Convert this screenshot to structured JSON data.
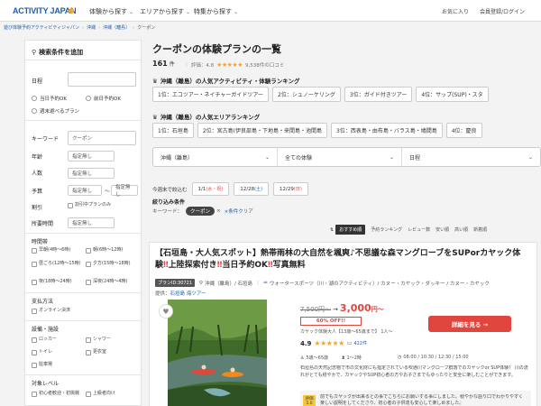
{
  "header": {
    "logo": "ACTIVITY JAPAN",
    "nav": [
      "体験から探す",
      "エリアから探す",
      "特集から探す"
    ],
    "favorites": "お気に入り",
    "member": "会員登録/ログイン"
  },
  "breadcrumb": {
    "items": [
      "遊び体験予約アクティビティジャパン",
      "沖縄",
      "沖縄（離島）"
    ],
    "current": "クーポン"
  },
  "sidebar": {
    "title": "検索条件を追加",
    "date_label": "日程",
    "date_options": [
      "当日予約OK",
      "前日予約OK",
      "週末遊べるプラン"
    ],
    "keyword_label": "キーワード",
    "keyword_value": "クーポン",
    "age_label": "年齢",
    "age_placeholder": "指定無し",
    "people_label": "人数",
    "people_placeholder": "指定無し",
    "budget_label": "予算",
    "budget_min": "指定無し",
    "budget_sep": "〜",
    "budget_max": "指定無し",
    "discount_label": "割引",
    "discount_option": "割引中プランのみ",
    "duration_label": "所要時間",
    "duration_placeholder": "指定無し",
    "time_label": "時間帯",
    "time_options": [
      "早朝(4時〜6時)",
      "朝(6時〜12時)",
      "昼ごろ(12時〜15時)",
      "夕方(15時〜18時)",
      "夜(18時〜24時)",
      "深夜(24時〜4時)"
    ],
    "payment_label": "支払方法",
    "payment_option": "オンライン決済",
    "facility_label": "設備・施設",
    "facility_options": [
      "ロッカー",
      "シャワー",
      "トイレ",
      "更衣室",
      "駐車場"
    ],
    "target_label": "対象レベル",
    "target_options": [
      "初心者歓迎・初挑戦",
      "上級者向け"
    ]
  },
  "main": {
    "title": "クーポンの体験プランの一覧",
    "count": "161",
    "count_unit": "件",
    "rating_label": "評価：4.8",
    "rating_reviews": "9,538件の口コミ",
    "activity_ranking_title": "沖縄（離島）の人気アクティビティ・体験ランキング",
    "activity_ranking": [
      "1位：エコツアー・ネイチャーガイドツアー",
      "2位：シュノーケリング",
      "3位：ガイド付きツアー",
      "4位：サップ(SUP)・スタ"
    ],
    "area_ranking_title": "沖縄（離島）の人気エリアランキング",
    "area_ranking": [
      "1位：石垣島",
      "2位：宮古島(伊良部島・下地島・来間島・池間島",
      "3位：西表島・由布島・バラス島・鳩間島",
      "4位：慶良"
    ],
    "search": {
      "area": "沖縄（離島）",
      "category": "全ての体験",
      "date": "日程"
    },
    "quick_label": "今週末で絞込む",
    "quick_dates": [
      {
        "d": "1/1",
        "w": "(水・祝)"
      },
      {
        "d": "12/28",
        "w": "(土)"
      },
      {
        "d": "12/29",
        "w": "(日)"
      }
    ],
    "filter_title": "絞り込み条件",
    "filter_keyword_label": "キーワード：",
    "filter_keyword_chip": "クーポン",
    "filter_clear": "条件クリア",
    "sort": [
      "おすすめ順",
      "予約ランキング",
      "レビュー数",
      "安い順",
      "高い順",
      "新着順"
    ]
  },
  "card": {
    "title_a": "【石垣島・大人気スポット】熱帯雨林の大自然を颯爽♪不思議な森マングローブをSUPorカヤック体験",
    "title_b": "上陸探索付き",
    "title_c": "当日予約OK",
    "title_d": "写真無料",
    "bang": "‼",
    "plan_id": "プランID:30721",
    "location": "沖縄（離島）/ 石垣島",
    "category": "ウォータースポーツ（川・湖のアクティビティ）/ カヌー・カヤック・ダッキー / カヌー・カヤック",
    "provider_label": "提供：",
    "provider": "石垣島 海ツアー",
    "old_price": "7,500円〜",
    "new_price": "3,000",
    "new_price_unit": "円〜",
    "off": "60% OFF!!",
    "price_note": "カヤック体験大人【13歳〜65歳まで】 1人〜",
    "detail_btn": "詳細を見る →",
    "score": "4.9",
    "review_count": "422件",
    "age": "5歳〜65歳",
    "duration": "1〜2時",
    "times": "08:00 / 10:30 / 12:30 / 15:00",
    "description": "石垣島の天然記念物で市の文化財にも指定されている吹通川マングローブ群落でのカヤックor SUP体験！ 川の流れがとても穏やかで、カヤックやSUP初心者の方やお子さまでもゆったりと安全に楽しむことができます。",
    "review_badge_a": "評価",
    "review_badge_b": "5.0",
    "review_text": "前でもカヤックが出来るとの事でこちらにお願いする事にしました。穏やかな語り口でわかりやすく楽しい説明をしてくださり、初心者の子供達も安心して楽しめました。"
  },
  "colors": {
    "brand_blue": "#1a5fae",
    "accent_red": "#e0463e",
    "star": "#f5a623"
  }
}
